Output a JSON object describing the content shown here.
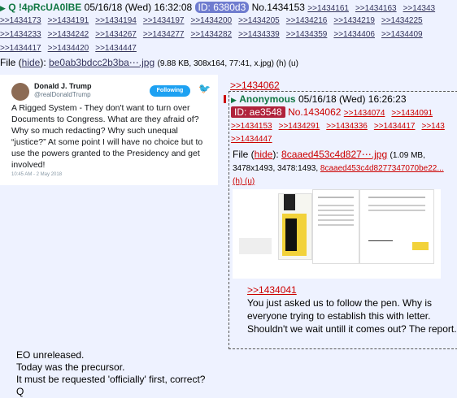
{
  "post": {
    "tripcode": "Q !4pRcUA0lBE",
    "date": "05/16/18 (Wed) 16:32:08",
    "id_label": "ID: 6380d3",
    "number": "No.1434153",
    "replies_row1": [
      ">>1434161",
      ">>1434163",
      ">>14343"
    ],
    "replies_row2": [
      ">>1434173",
      ">>1434191",
      ">>1434194",
      ">>1434197",
      ">>1434200",
      ">>1434205",
      ">>1434216",
      ">>1434219",
      ">>1434225"
    ],
    "replies_row3": [
      ">>1434233",
      ">>1434242",
      ">>1434267",
      ">>1434277",
      ">>1434282",
      ">>1434339",
      ">>1434359",
      ">>1434406",
      ">>1434409"
    ],
    "replies_row4": [
      ">>1434417",
      ">>1434420",
      ">>1434447"
    ],
    "file_label": "File (",
    "file_hide": "hide",
    "file_label_end": "):",
    "file_name": "be0ab3bdcc2b3ba⋯.jpg",
    "file_meta": "(9.88 KB, 308x164, 77:41, x.jpg) (h) (u)",
    "body_lines": [
      "EO unreleased.",
      "Today was the precursor.",
      "It must be requested 'officially' first, correct?",
      "Q"
    ]
  },
  "tweet": {
    "name": "Donald J. Trump",
    "handle": "@realDonaldTrump",
    "follow_label": "Following",
    "text": "A Rigged System - They don't want to turn over Documents to Congress. What are they afraid of? Why so much redacting? Why such unequal “justice?” At some point I will have no choice but to use the powers granted to the Presidency and get involved!",
    "date": "10:45 AM - 2 May 2018"
  },
  "reply": {
    "backlink": ">>1434062",
    "name": "Anonymous",
    "date": "05/16/18 (Wed) 16:26:23",
    "id_label": "ID: ae3548",
    "number": "No.1434062",
    "replies_row1": [
      ">>1434074",
      ">>1434091"
    ],
    "replies_row2": [
      ">>1434153",
      ">>1434291",
      ">>1434336",
      ">>1434417",
      ">>143"
    ],
    "replies_row3": [
      ">>1434447"
    ],
    "file_label": "File (",
    "file_hide": "hide",
    "file_label_end": "):",
    "file_name": "8caaed453c4d827⋯.jpg",
    "file_meta1": "(1.09 MB,",
    "file_meta2": "3478x1493, 3478:1493,",
    "file_orig": "8caaed453c4d8277347070be22...",
    "file_hu": "(h) (u)",
    "quote": ">>1434041",
    "text": "You just asked us to follow the pen. Why is everyone trying to establish this with letter. Shouldn't we wait untill it comes out? The report."
  }
}
